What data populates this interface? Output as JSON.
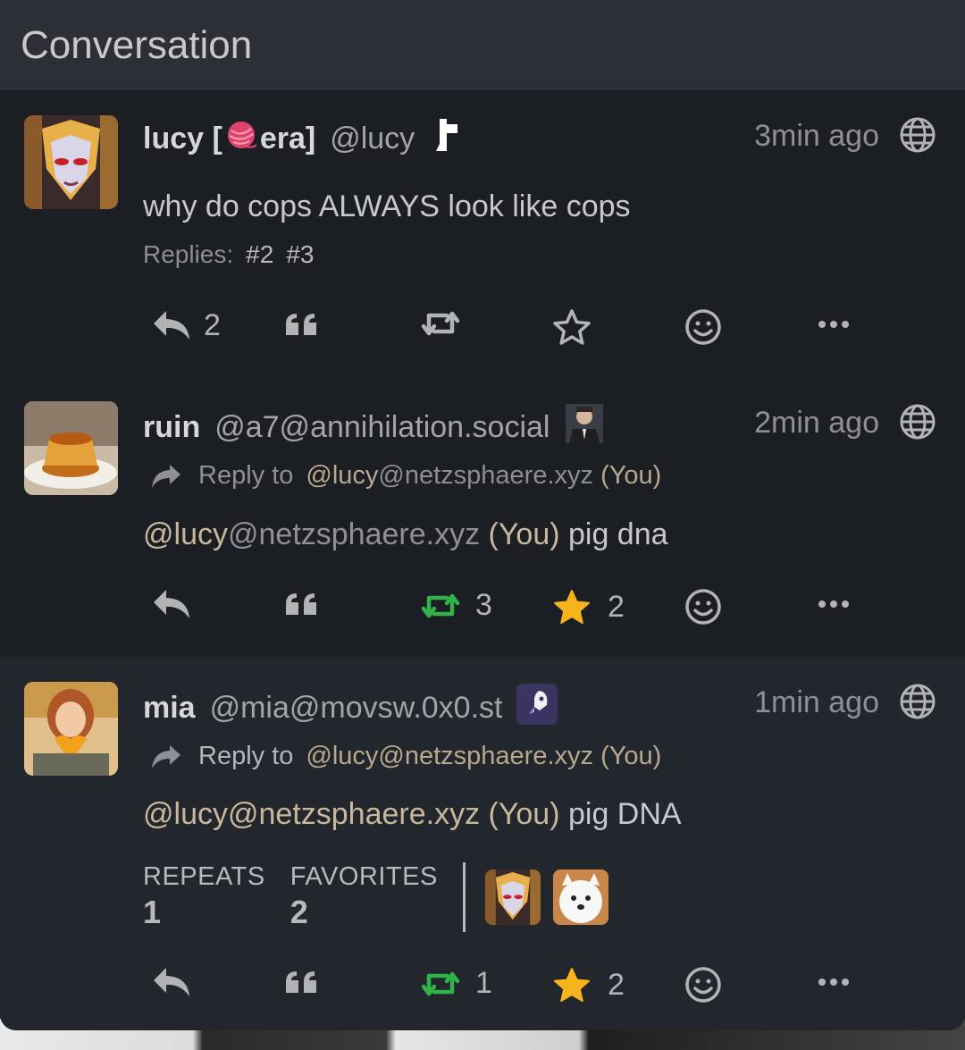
{
  "header": {
    "title": "Conversation"
  },
  "statuses": [
    {
      "display_name": "lucy [",
      "display_name_end": " era]",
      "acct": "@lucy",
      "time": "3min ago",
      "text": "why do cops ALWAYS look like cops",
      "replies_label": "Replies:",
      "replies": [
        "#2",
        "#3"
      ],
      "actions": {
        "reply_count": "2",
        "repeat_count": "",
        "fav_count": ""
      }
    },
    {
      "display_name": "ruin",
      "acct": "@a7@annihilation.social",
      "time": "2min ago",
      "reply_to_label": "Reply to",
      "reply_to_user": "@lucy",
      "reply_to_host": "@netzsphaere.xyz",
      "reply_to_you": " (You)",
      "text_mention_user": "@lucy",
      "text_mention_host": "@netzsphaere.xyz",
      "text_mention_you": " (You)",
      "text_rest": " pig dna",
      "actions": {
        "reply_count": "",
        "repeat_count": "3",
        "fav_count": "2"
      }
    },
    {
      "display_name": "mia",
      "acct": "@mia@movsw.0x0.st",
      "time": "1min ago",
      "reply_to_label": "Reply to",
      "reply_to_user": "@lucy@netzsphaere.xyz",
      "reply_to_you": " (You)",
      "text_mention": "@lucy@netzsphaere.xyz (You)",
      "text_rest": " pig DNA",
      "stats": {
        "repeats_label": "REPEATS",
        "repeats": "1",
        "favorites_label": "FAVORITES",
        "favorites": "2"
      },
      "actions": {
        "reply_count": "",
        "repeat_count": "1",
        "fav_count": "2"
      }
    }
  ],
  "colors": {
    "repeat_active": "#2fb34a",
    "fav_active": "#f5b41b",
    "icon": "#b2b3b5"
  }
}
